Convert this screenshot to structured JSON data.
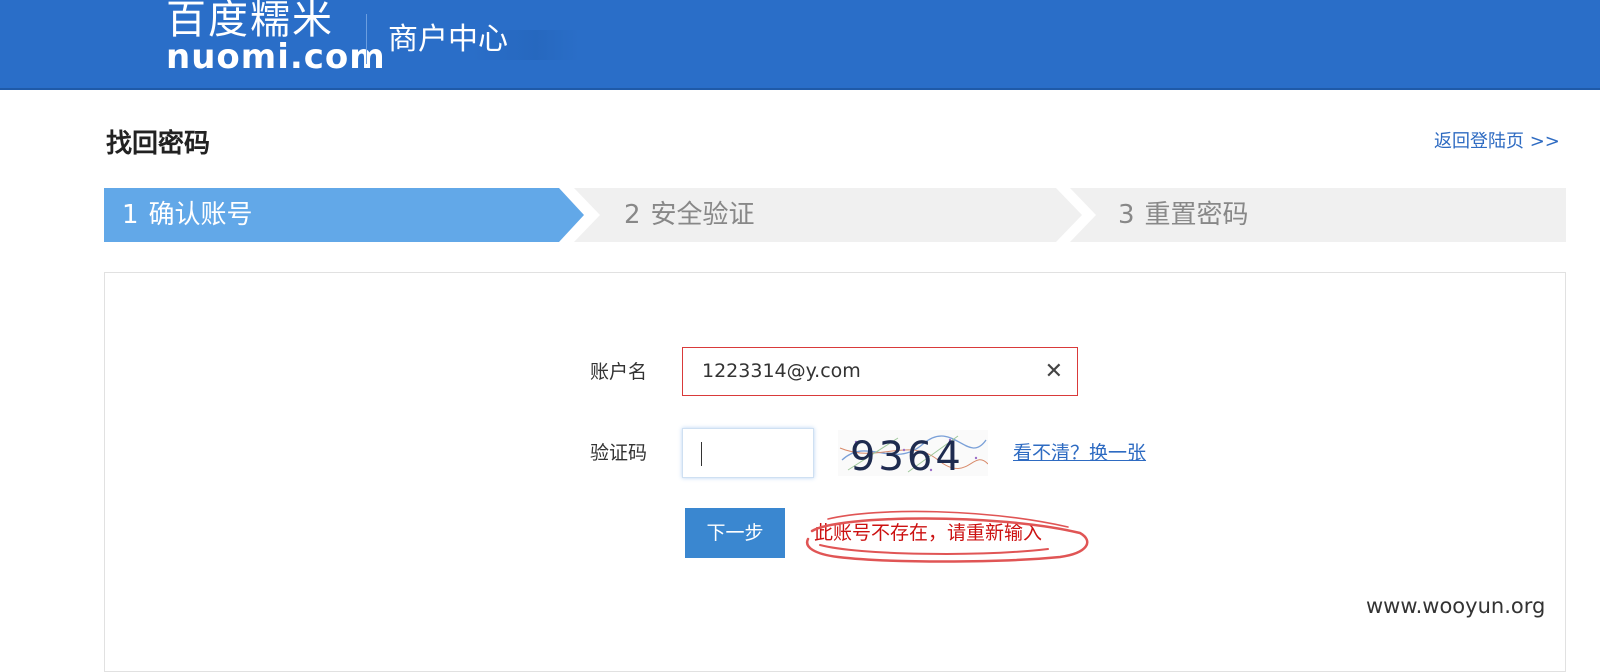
{
  "header": {
    "logo_cn": "百度糯米",
    "logo_en": "nuomi.com",
    "subtitle": "商户中心"
  },
  "page": {
    "title": "找回密码",
    "back_link": "返回登陆页 >>"
  },
  "steps": [
    {
      "number": "1",
      "label": "确认账号",
      "active": true
    },
    {
      "number": "2",
      "label": "安全验证",
      "active": false
    },
    {
      "number": "3",
      "label": "重置密码",
      "active": false
    }
  ],
  "form": {
    "account_label": "账户名",
    "account_value": "1223314@y.com",
    "clear_icon": "close-icon",
    "captcha_label": "验证码",
    "captcha_value": "",
    "captcha_image_text": "9364",
    "refresh_link": "看不清？换一张",
    "next_button": "下一步",
    "error_message": "此账号不存在，请重新输入"
  },
  "watermark": "www.wooyun.org",
  "colors": {
    "header_bg": "#2a6ec8",
    "step_active": "#62a8e8",
    "step_inactive": "#f0f0f0",
    "link": "#2e6bc2",
    "error": "#cc1111",
    "button": "#3a87d0",
    "annotation": "#e05555"
  }
}
